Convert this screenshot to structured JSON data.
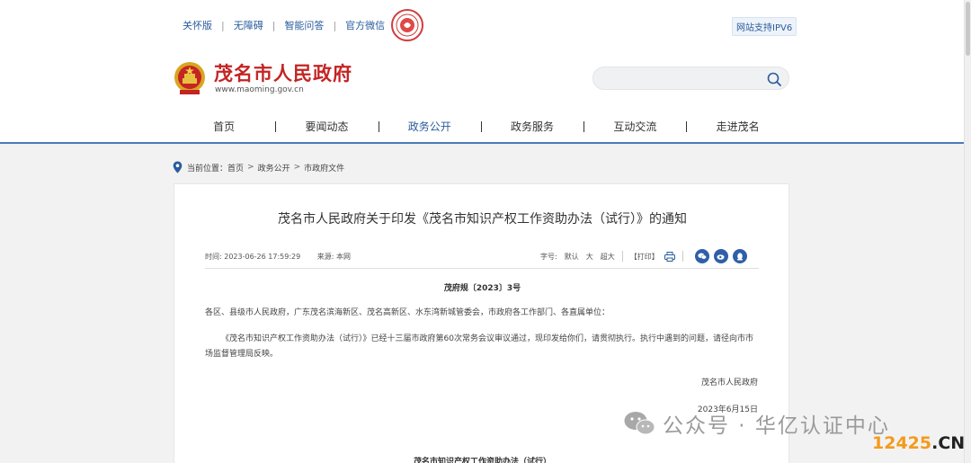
{
  "top_links": [
    "关怀版",
    "无障碍",
    "智能问答",
    "官方微信"
  ],
  "ipv6": "网站支持IPV6",
  "site": {
    "name": "茂名市人民政府",
    "url": "www.maoming.gov.cn"
  },
  "search": {
    "placeholder": "",
    "value": ""
  },
  "nav": {
    "items": [
      "首页",
      "要闻动态",
      "政务公开",
      "政务服务",
      "互动交流",
      "走进茂名"
    ],
    "active": "政务公开"
  },
  "breadcrumb": {
    "label": "当前位置：",
    "items": [
      "首页",
      "政务公开",
      "市政府文件"
    ],
    "separator": ">"
  },
  "article": {
    "title": "茂名市人民政府关于印发《茂名市知识产权工作资助办法（试行）》的通知",
    "time_label": "时间: 2023-06-26 17:59:29",
    "source_label": "来源: 本网",
    "font_label": "字号:",
    "font_sizes": [
      "默认",
      "大",
      "超大"
    ],
    "print_label": "【打印】",
    "doc_number": "茂府规〔2023〕3号",
    "recipients": "各区、县级市人民政府，广东茂名滨海新区、茂名高新区、水东湾新城管委会，市政府各工作部门、各直属单位：",
    "body": "《茂名市知识产权工作资助办法（试行）》已经十三届市政府第60次常务会议审议通过，现印发给你们，请贯彻执行。执行中遇到的问题，请径向市市场监督管理局反映。",
    "signature": "茂名市人民政府",
    "date": "2023年6月15日",
    "attachment_title": "茂名市知识产权工作资助办法（试行）"
  },
  "watermark": {
    "text": "公众号 · 华亿认证中心",
    "site_a": "12425",
    "site_b": ".CN"
  },
  "colors": {
    "brand_red": "#c42424",
    "link_blue": "#2a5c9c",
    "share_blue": "#2f5fa8",
    "nav_underline": "#4a7bb7",
    "watermark_orange": "#f59a1b"
  }
}
